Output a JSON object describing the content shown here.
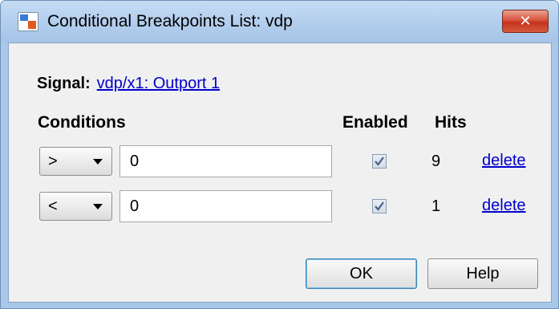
{
  "window": {
    "title": "Conditional Breakpoints List: vdp",
    "close_glyph": "✕",
    "icon": "simulink-model-icon"
  },
  "signal": {
    "label": "Signal:",
    "link_text": "vdp/x1: Outport 1"
  },
  "headers": {
    "conditions": "Conditions",
    "enabled": "Enabled",
    "hits": "Hits"
  },
  "conditions": [
    {
      "operator": ">",
      "value": "0",
      "enabled": true,
      "hits": "9",
      "delete_label": "delete"
    },
    {
      "operator": "<",
      "value": "0",
      "enabled": true,
      "hits": "1",
      "delete_label": "delete"
    }
  ],
  "buttons": {
    "ok": "OK",
    "help": "Help"
  },
  "colors": {
    "link": "#0000cc",
    "frame": "#a9c7e8",
    "close_button": "#c6331e"
  }
}
